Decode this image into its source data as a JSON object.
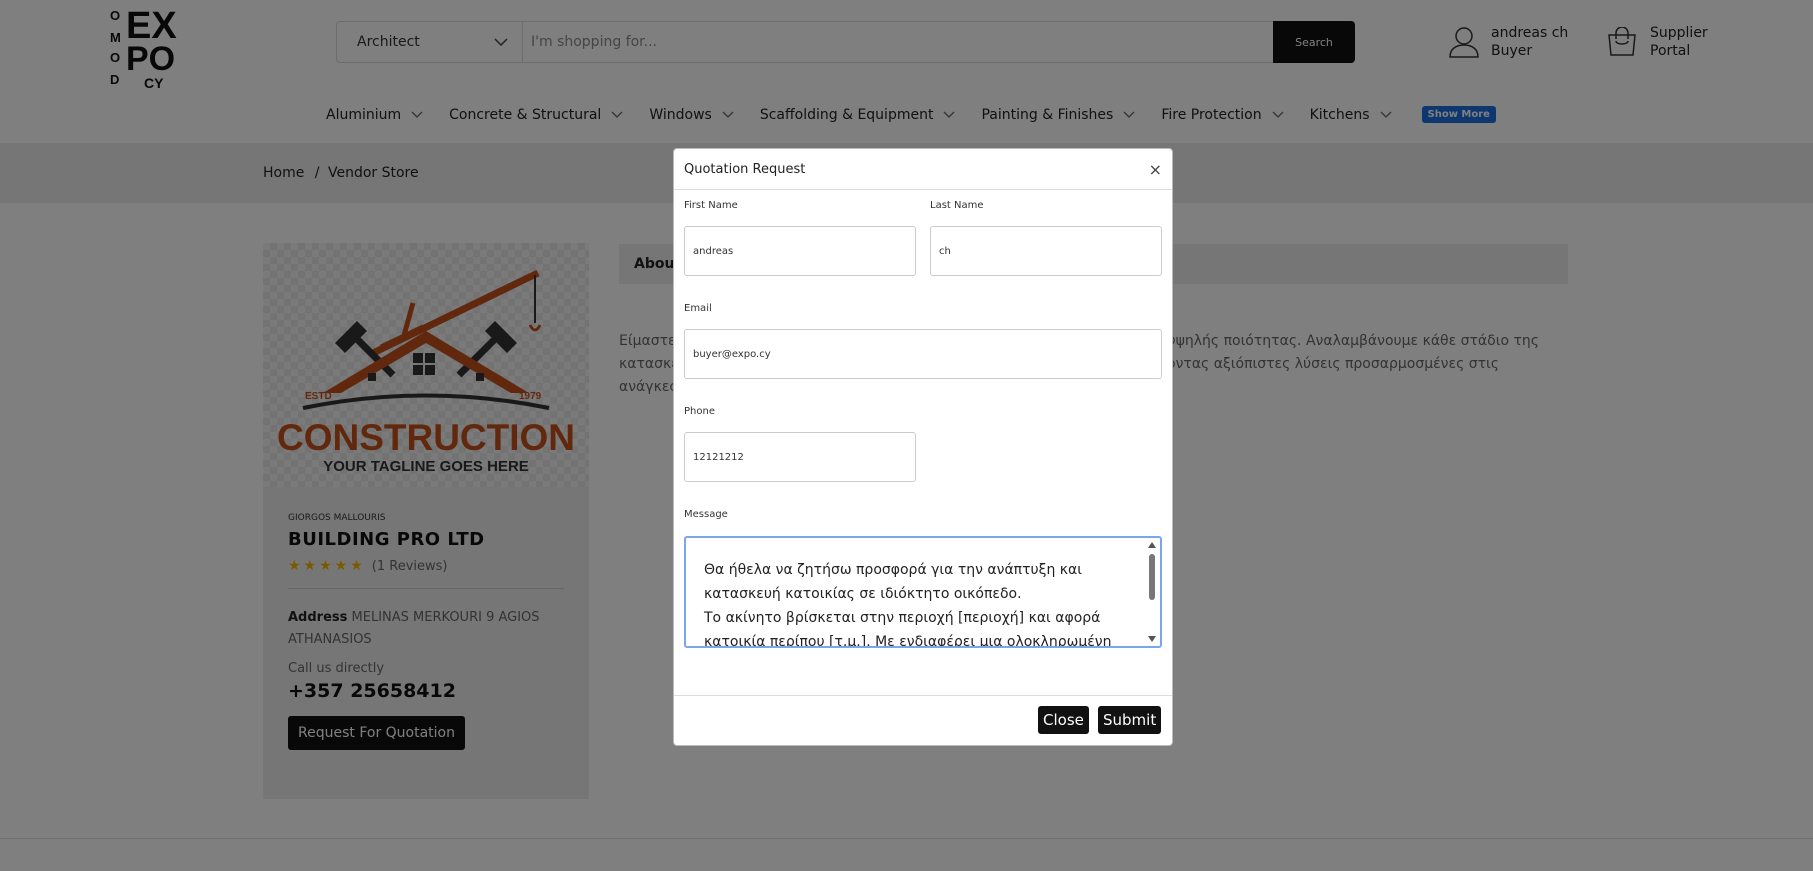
{
  "header": {
    "search": {
      "category": "Architect",
      "placeholder": "I'm shopping for...",
      "button": "Search"
    },
    "user": {
      "name": "andreas ch",
      "role": "Buyer"
    },
    "portal": {
      "line1": "Supplier",
      "line2": "Portal"
    },
    "nav": [
      "Aluminium",
      "Concrete & Structural",
      "Windows",
      "Scaffolding & Equipment",
      "Painting & Finishes",
      "Fire Protection",
      "Kitchens"
    ],
    "show_more": "Show More"
  },
  "breadcrumb": {
    "home": "Home",
    "separator": "/",
    "current": "Vendor Store"
  },
  "vendor": {
    "logo_estd": "ESTD",
    "logo_year": "1979",
    "logo_word": "CONSTRUCTION",
    "logo_tagline": "YOUR TAGLINE GOES HERE",
    "owner": "GIORGOS MALLOURIS",
    "name": "BUILDING PRO LTD",
    "stars": "★★★★★",
    "reviews": "(1 Reviews)",
    "address_label": "Address",
    "address": "MELINAS MERKOURI 9 AGIOS ATHANASIOS",
    "call_label": "Call us directly",
    "phone": "+357 25658412",
    "quote_button": "Request For Quotation"
  },
  "about": {
    "tab": "About",
    "text_left_1": "Είμαστε",
    "text_left_2": "κατασκευ",
    "text_left_3": "ανάγκες",
    "text_right_1": "ών έργων υψηλής ποιότητας. Αναλαμβάνουμε κάθε στάδιο της",
    "text_right_2": ", προσφέροντας αξιόπιστες λύσεις προσαρμοσμένες στις"
  },
  "modal": {
    "title": "Quotation Request",
    "close_x": "×",
    "first_name_label": "First Name",
    "first_name": "andreas",
    "last_name_label": "Last Name",
    "last_name": "ch",
    "email_label": "Email",
    "email": "buyer@expo.cy",
    "phone_label": "Phone",
    "phone": "12121212",
    "message_label": "Message",
    "message_line1": "Θα ήθελα να ζητήσω προσφορά για την ανάπτυξη και",
    "message_line2": "κατασκευή κατοικίας σε ιδιόκτητο οικόπεδο.",
    "message_line3": "Το ακίνητο βρίσκεται στην περιοχή [περιοχή] και αφορά",
    "message_line4": "κατοικία περίπου [τ.μ.]. Με ενδιαφέρει μια ολοκληρωμένη",
    "close_button": "Close",
    "submit_button": "Submit"
  },
  "colors": {
    "accent": "#1f6fde",
    "dark": "#111111",
    "brand_orange": "#c4501b",
    "star": "#f5b400"
  }
}
